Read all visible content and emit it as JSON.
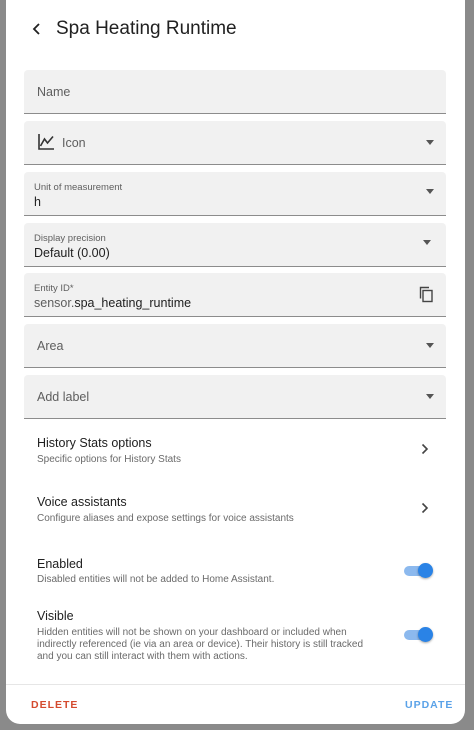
{
  "header": {
    "title": "Spa Heating Runtime"
  },
  "fields": {
    "name": {
      "label": "Name",
      "value": ""
    },
    "icon": {
      "label": "Icon",
      "icon": "chart-line-icon"
    },
    "unit": {
      "label": "Unit of measurement",
      "value": "h"
    },
    "precision": {
      "label": "Display precision",
      "value": "Default (0.00)"
    },
    "entity_id": {
      "label": "Entity ID*",
      "prefix": "sensor.",
      "value": "spa_heating_runtime"
    },
    "area": {
      "label": "Area"
    },
    "add_label": {
      "label": "Add label"
    }
  },
  "history_stats": {
    "title": "History Stats options",
    "subtitle": "Specific options for History Stats"
  },
  "voice": {
    "title": "Voice assistants",
    "subtitle": "Configure aliases and expose settings for voice assistants"
  },
  "enabled": {
    "title": "Enabled",
    "subtitle": "Disabled entities will not be added to Home Assistant.",
    "on": true
  },
  "visible": {
    "title": "Visible",
    "subtitle_lines": [
      "Hidden entities will not be shown on your dashboard or included when",
      "indirectly referenced (ie via an area or device). Their history is still tracked",
      "and you can still interact with them with actions."
    ],
    "on": true
  },
  "footer": {
    "delete_label": "DELETE",
    "update_label": "UPDATE"
  },
  "colors": {
    "accent": "#2a83e6",
    "delete": "#d44a2e",
    "field_bg": "#f1f1f1"
  }
}
